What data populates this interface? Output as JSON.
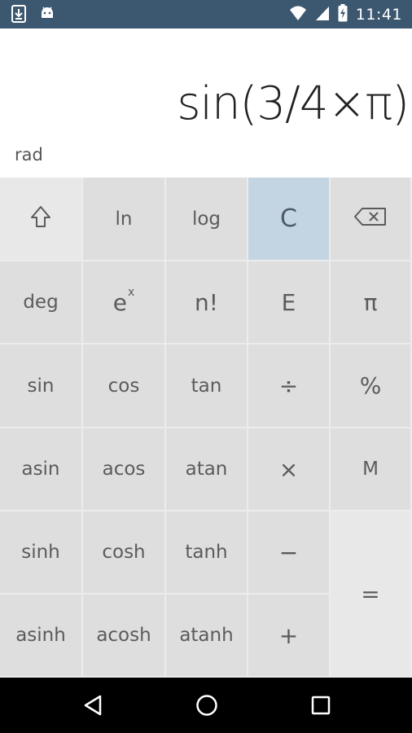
{
  "status_bar": {
    "time": "11:41",
    "left_icons": [
      "download-icon",
      "android-icon"
    ],
    "right_icons": [
      "wifi-icon",
      "signal-icon",
      "battery-charging-icon"
    ]
  },
  "display": {
    "expression": "sin(3/4×π)",
    "angle_mode": "rad"
  },
  "keys": {
    "shift": "⇧",
    "ln": "ln",
    "log": "log",
    "clear": "C",
    "backspace": "⌫",
    "deg": "deg",
    "exp_base": "e",
    "exp_sup": "x",
    "factorial": "n!",
    "sci_e": "E",
    "pi": "π",
    "sin": "sin",
    "cos": "cos",
    "tan": "tan",
    "divide": "÷",
    "percent": "%",
    "asin": "asin",
    "acos": "acos",
    "atan": "atan",
    "multiply": "×",
    "memory": "M",
    "sinh": "sinh",
    "cosh": "cosh",
    "tanh": "tanh",
    "minus": "−",
    "asinh": "asinh",
    "acosh": "acosh",
    "atanh": "atanh",
    "plus": "+",
    "equals": "="
  },
  "nav_bar": {
    "icons": [
      "back-icon",
      "home-icon",
      "recents-icon"
    ]
  },
  "colors": {
    "status_bar": "#3c5770",
    "key_default": "#dedede",
    "key_clear": "#c3d5e3",
    "key_light": "#e8e8e8"
  }
}
